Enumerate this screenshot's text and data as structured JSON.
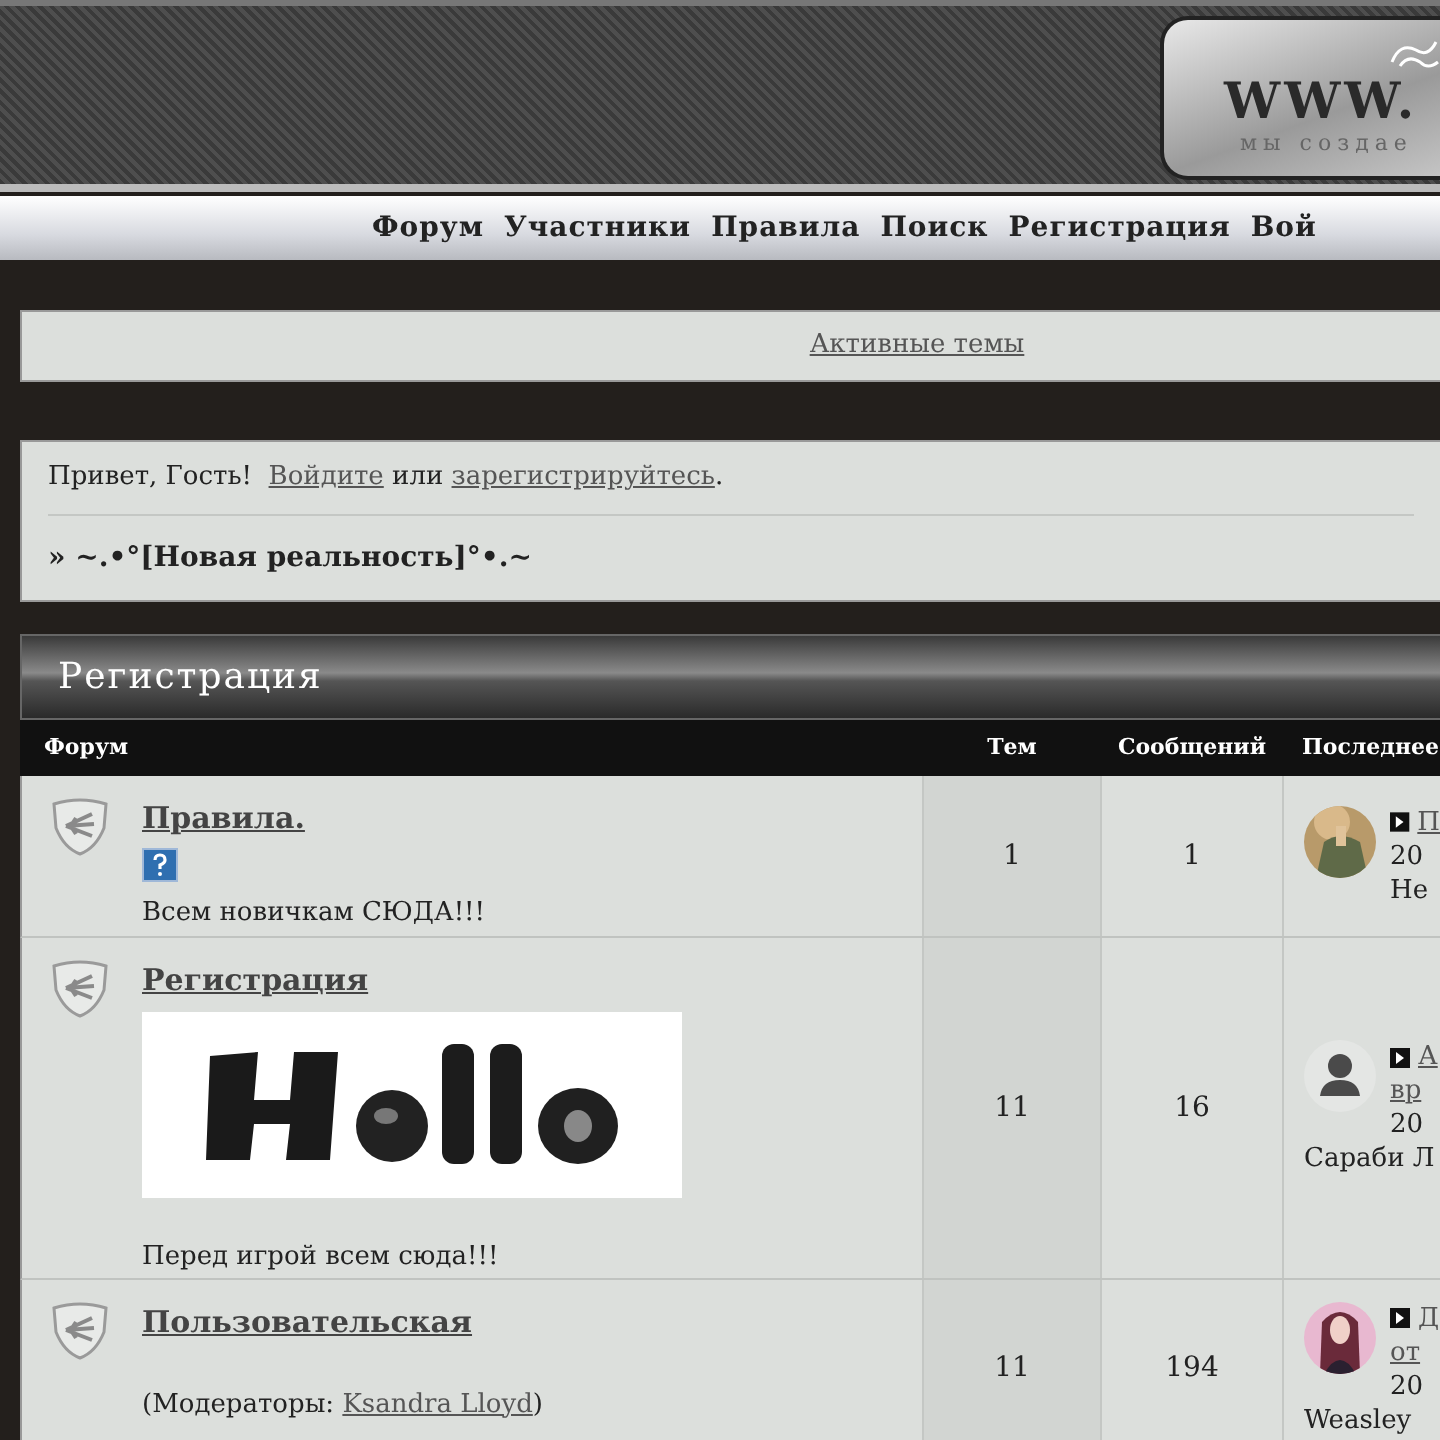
{
  "header": {
    "logo_text": "WWW.",
    "logo_tagline": "мы создае"
  },
  "nav": [
    "Форум",
    "Участники",
    "Правила",
    "Поиск",
    "Регистрация",
    "Вой"
  ],
  "active_topics": "Активные темы",
  "greeting": {
    "before": "Привет, Гость!",
    "login": "Войдите",
    "middle": "или",
    "register": "зарегистрируйтесь",
    "after": "."
  },
  "breadcrumb": "» ~.•°[Новая реальность]°•.~",
  "category": {
    "title": "Регистрация",
    "columns": [
      "Форум",
      "Тем",
      "Сообщений",
      "Последнее"
    ],
    "forums": [
      {
        "name": "Правила.",
        "kind": "help",
        "description": "Всем новичкам СЮДА!!!",
        "topics": "1",
        "posts": "1",
        "last_post": {
          "avatar": {
            "kind": "picture"
          },
          "links": [
            "П"
          ],
          "date": "20",
          "author": "Не"
        }
      },
      {
        "name": "Регистрация",
        "kind": "banner",
        "description": "Перед игрой всем сюда!!!",
        "topics": "11",
        "posts": "16",
        "last_post": {
          "avatar": {
            "kind": "silhouette"
          },
          "links": [
            "А",
            "вр"
          ],
          "date": "20",
          "author": "Сараби Л"
        }
      },
      {
        "name": "Пользовательская",
        "kind": "moderated",
        "moderators_prefix": "(Модераторы: ",
        "moderators": [
          "Ksandra Lloyd"
        ],
        "moderators_suffix": ")",
        "topics": "11",
        "posts": "194",
        "last_post": {
          "avatar": {
            "kind": "picture"
          },
          "links": [
            "Д",
            "от"
          ],
          "date": "20",
          "author": "Weasley"
        }
      }
    ]
  }
}
